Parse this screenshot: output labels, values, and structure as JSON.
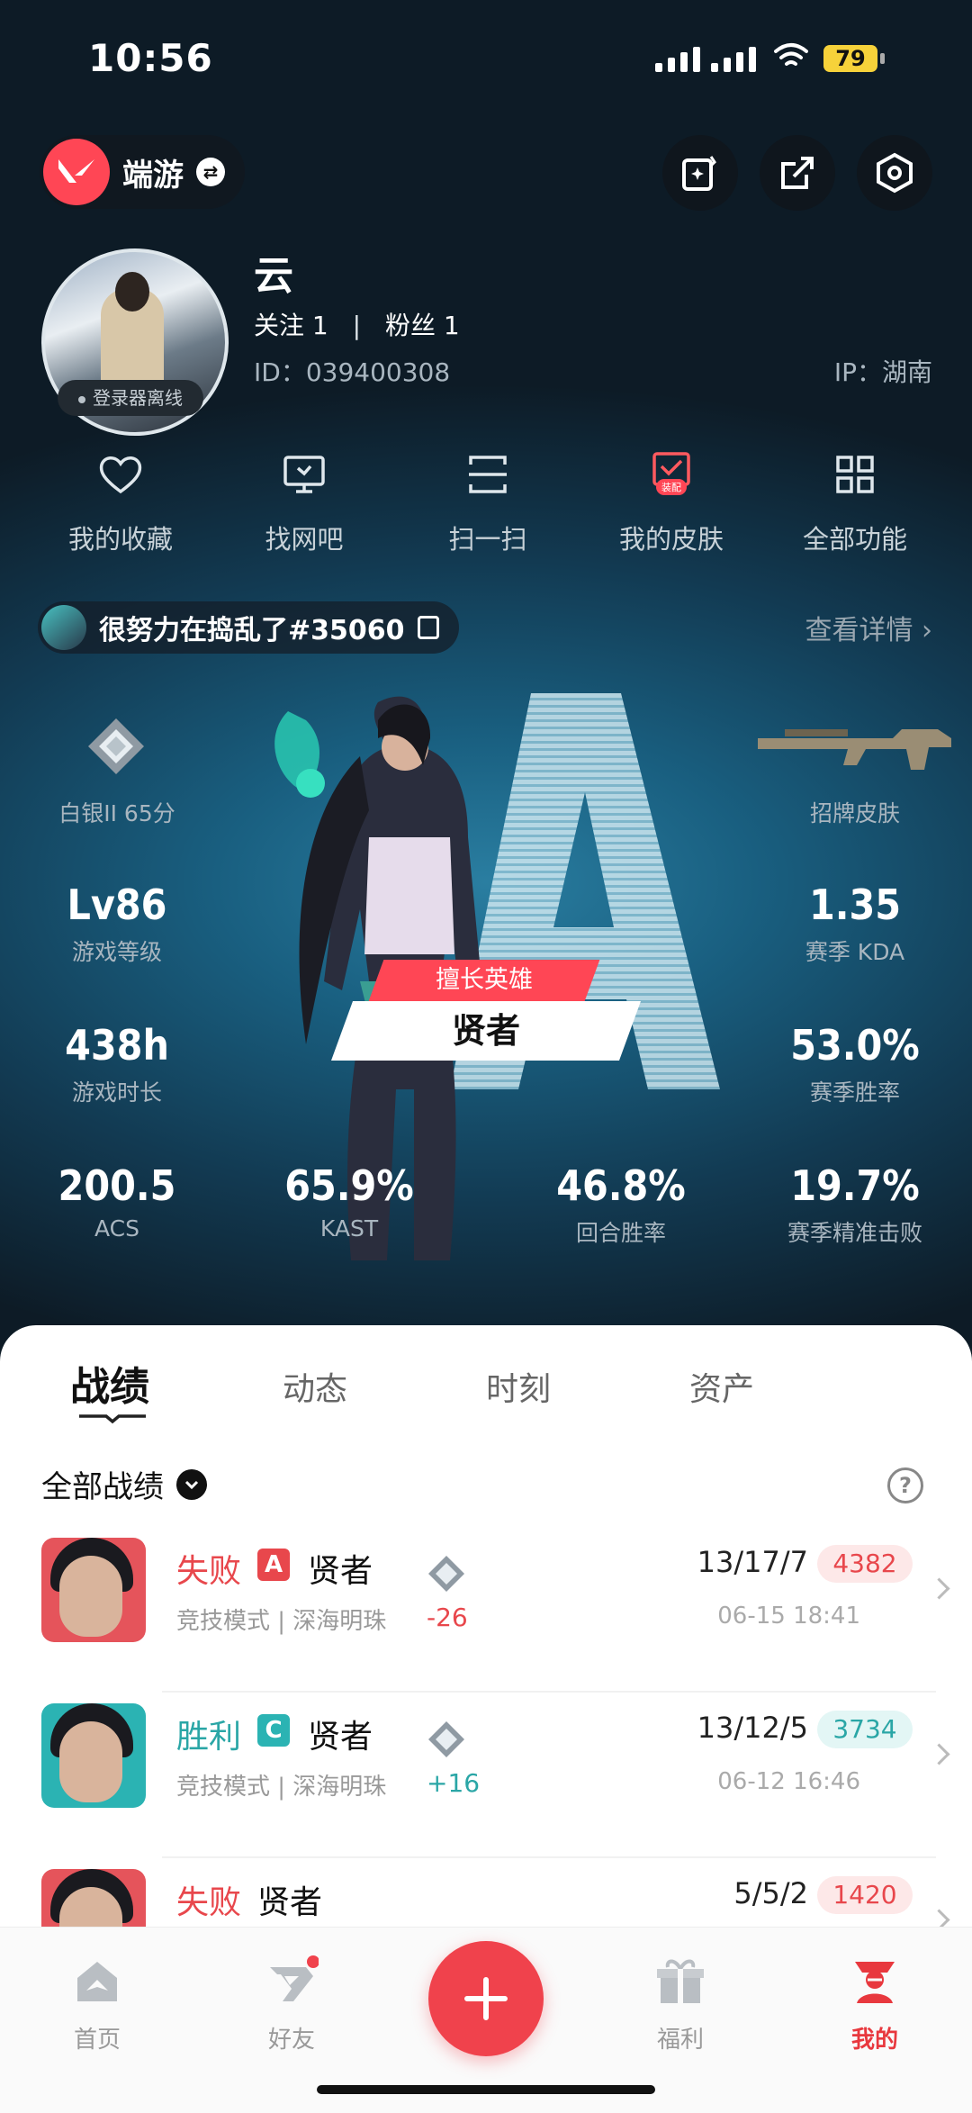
{
  "status_bar": {
    "time": "10:56",
    "battery": "79"
  },
  "header": {
    "mode_label": "端游"
  },
  "profile": {
    "name": "云",
    "follow_label": "关注 1",
    "fans_label": "粉丝 1",
    "separator": "|",
    "id_text": "ID：039400308",
    "ip_text": "IP：湖南",
    "offline_text": "登录器离线"
  },
  "quick_actions": [
    {
      "label": "我的收藏",
      "icon": "heart-icon"
    },
    {
      "label": "找网吧",
      "icon": "monitor-icon"
    },
    {
      "label": "扫一扫",
      "icon": "scan-icon"
    },
    {
      "label": "我的皮肤",
      "icon": "skin-icon",
      "badge": "装配"
    },
    {
      "label": "全部功能",
      "icon": "grid-icon"
    }
  ],
  "player_card": {
    "riot_id": "很努力在捣乱了#35060",
    "detail_link": "查看详情"
  },
  "stats": {
    "rank": {
      "label": "白银II 65分"
    },
    "skin": {
      "label": "招牌皮肤"
    },
    "level": {
      "value": "Lv86",
      "label": "游戏等级"
    },
    "hours": {
      "value": "438h",
      "label": "游戏时长"
    },
    "kda": {
      "value": "1.35",
      "label": "赛季 KDA"
    },
    "winrate": {
      "value": "53.0%",
      "label": "赛季胜率"
    },
    "acs": {
      "value": "200.5",
      "label": "ACS"
    },
    "kast": {
      "value": "65.9%",
      "label": "KAST"
    },
    "round_win": {
      "value": "46.8%",
      "label": "回合胜率"
    },
    "hs": {
      "value": "19.7%",
      "label": "赛季精准击败"
    }
  },
  "hero": {
    "tag": "擅长英雄",
    "name": "贤者"
  },
  "tabs": [
    "战绩",
    "动态",
    "时刻",
    "资产"
  ],
  "filter": {
    "label": "全部战绩",
    "help": "?"
  },
  "matches": [
    {
      "result": "失败",
      "letter": "A",
      "agent": "贤者",
      "mode": "竞技模式 | 深海明珠",
      "delta": "-26",
      "score": "13/17/7",
      "points": "4382",
      "date": "06-15 18:41"
    },
    {
      "result": "胜利",
      "letter": "C",
      "agent": "贤者",
      "mode": "竞技模式 | 深海明珠",
      "delta": "+16",
      "score": "13/12/5",
      "points": "3734",
      "date": "06-12 16:46"
    },
    {
      "result": "失败",
      "agent": "贤者",
      "score": "5/5/2",
      "points": "1420"
    }
  ],
  "nav": [
    "首页",
    "好友",
    "福利",
    "我的"
  ],
  "colors": {
    "accent": "#ff4655",
    "loss": "#e8474c",
    "win": "#2bb3b3"
  }
}
